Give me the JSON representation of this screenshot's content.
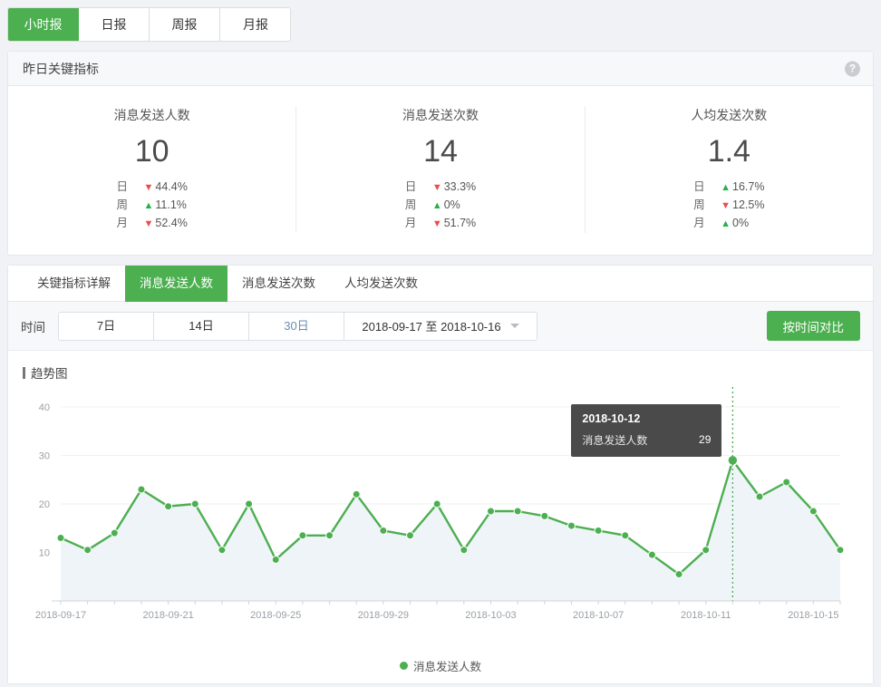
{
  "period_tabs": [
    {
      "label": "小时报",
      "active": false
    },
    {
      "label": "日报",
      "active": true
    },
    {
      "label": "周报",
      "active": false
    },
    {
      "label": "月报",
      "active": false
    }
  ],
  "summary_card": {
    "title": "昨日关键指标",
    "help_icon": "question-mark-icon",
    "metrics": [
      {
        "label": "消息发送人数",
        "value": "10",
        "deltas": [
          {
            "period": "日",
            "dir": "down",
            "value": "44.4%"
          },
          {
            "period": "周",
            "dir": "up",
            "value": "11.1%"
          },
          {
            "period": "月",
            "dir": "down",
            "value": "52.4%"
          }
        ]
      },
      {
        "label": "消息发送次数",
        "value": "14",
        "deltas": [
          {
            "period": "日",
            "dir": "down",
            "value": "33.3%"
          },
          {
            "period": "周",
            "dir": "up",
            "value": "0%"
          },
          {
            "period": "月",
            "dir": "down",
            "value": "51.7%"
          }
        ]
      },
      {
        "label": "人均发送次数",
        "value": "1.4",
        "deltas": [
          {
            "period": "日",
            "dir": "up",
            "value": "16.7%"
          },
          {
            "period": "周",
            "dir": "down",
            "value": "12.5%"
          },
          {
            "period": "月",
            "dir": "up",
            "value": "0%"
          }
        ]
      }
    ]
  },
  "detail_tabs": [
    {
      "label": "关键指标详解",
      "active": false
    },
    {
      "label": "消息发送人数",
      "active": true
    },
    {
      "label": "消息发送次数",
      "active": false
    },
    {
      "label": "人均发送次数",
      "active": false
    }
  ],
  "filter": {
    "label": "时间",
    "ranges": [
      {
        "label": "7日",
        "selected": false
      },
      {
        "label": "14日",
        "selected": false
      },
      {
        "label": "30日",
        "selected": true
      }
    ],
    "date_range": "2018-09-17 至 2018-10-16",
    "caret_icon": "chevron-down-icon",
    "compare_button": "按时间对比"
  },
  "trend": {
    "title": "趋势图",
    "tooltip": {
      "date": "2018-10-12",
      "series_name": "消息发送人数",
      "value": "29"
    },
    "legend": "消息发送人数"
  },
  "colors": {
    "accent_green": "#4caf50",
    "line_green": "#3eac3e",
    "up_green": "#21b34b",
    "down_red": "#f04b4b",
    "tooltip_bg": "#4a4a4a",
    "selected_range": "#6b8db5"
  },
  "chart_data": {
    "type": "line",
    "title": "趋势图",
    "xlabel": "",
    "ylabel": "",
    "ylim": [
      0,
      43
    ],
    "yticks": [
      10,
      20,
      30,
      40
    ],
    "grid": true,
    "legend_position": "bottom",
    "x": [
      "2018-09-17",
      "2018-09-18",
      "2018-09-19",
      "2018-09-20",
      "2018-09-21",
      "2018-09-22",
      "2018-09-23",
      "2018-09-24",
      "2018-09-25",
      "2018-09-26",
      "2018-09-27",
      "2018-09-28",
      "2018-09-29",
      "2018-09-30",
      "2018-10-01",
      "2018-10-02",
      "2018-10-03",
      "2018-10-04",
      "2018-10-05",
      "2018-10-06",
      "2018-10-07",
      "2018-10-08",
      "2018-10-09",
      "2018-10-10",
      "2018-10-11",
      "2018-10-12",
      "2018-10-13",
      "2018-10-14",
      "2018-10-15",
      "2018-10-16"
    ],
    "xtick_labels": [
      "2018-09-17",
      "2018-09-21",
      "2018-09-25",
      "2018-09-29",
      "2018-10-03",
      "2018-10-07",
      "2018-10-11",
      "2018-10-15"
    ],
    "series": [
      {
        "name": "消息发送人数",
        "color": "#4caf50",
        "values": [
          13,
          10.5,
          14,
          23,
          19.5,
          20,
          10.5,
          20,
          8.5,
          13.5,
          13.5,
          22,
          14.5,
          13.5,
          20,
          10.5,
          18.5,
          18.5,
          17.5,
          15.5,
          14.5,
          13.5,
          9.5,
          5.5,
          10.5,
          29,
          21.5,
          24.5,
          18.5,
          10.5
        ]
      }
    ],
    "highlight": {
      "x": "2018-10-12",
      "y": 29
    }
  }
}
